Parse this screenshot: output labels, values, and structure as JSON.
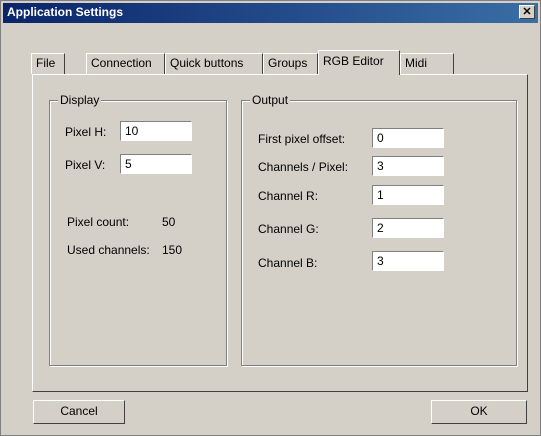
{
  "window": {
    "title": "Application Settings",
    "close_label": "✕"
  },
  "tabs": [
    {
      "label": "File"
    },
    {
      "label": "Connection"
    },
    {
      "label": "Quick buttons"
    },
    {
      "label": "Groups"
    },
    {
      "label": "RGB Editor"
    },
    {
      "label": "Midi"
    }
  ],
  "active_tab": "RGB Editor",
  "display": {
    "group_label": "Display",
    "pixel_h_label": "Pixel H:",
    "pixel_h_value": "10",
    "pixel_v_label": "Pixel V:",
    "pixel_v_value": "5",
    "pixel_count_label": "Pixel count:",
    "pixel_count_value": "50",
    "used_channels_label": "Used channels:",
    "used_channels_value": "150"
  },
  "output": {
    "group_label": "Output",
    "first_pixel_offset_label": "First pixel offset:",
    "first_pixel_offset_value": "0",
    "channels_per_pixel_label": "Channels / Pixel:",
    "channels_per_pixel_value": "3",
    "channel_r_label": "Channel R:",
    "channel_r_value": "1",
    "channel_g_label": "Channel G:",
    "channel_g_value": "2",
    "channel_b_label": "Channel B:",
    "channel_b_value": "3"
  },
  "buttons": {
    "cancel": "Cancel",
    "ok": "OK"
  }
}
